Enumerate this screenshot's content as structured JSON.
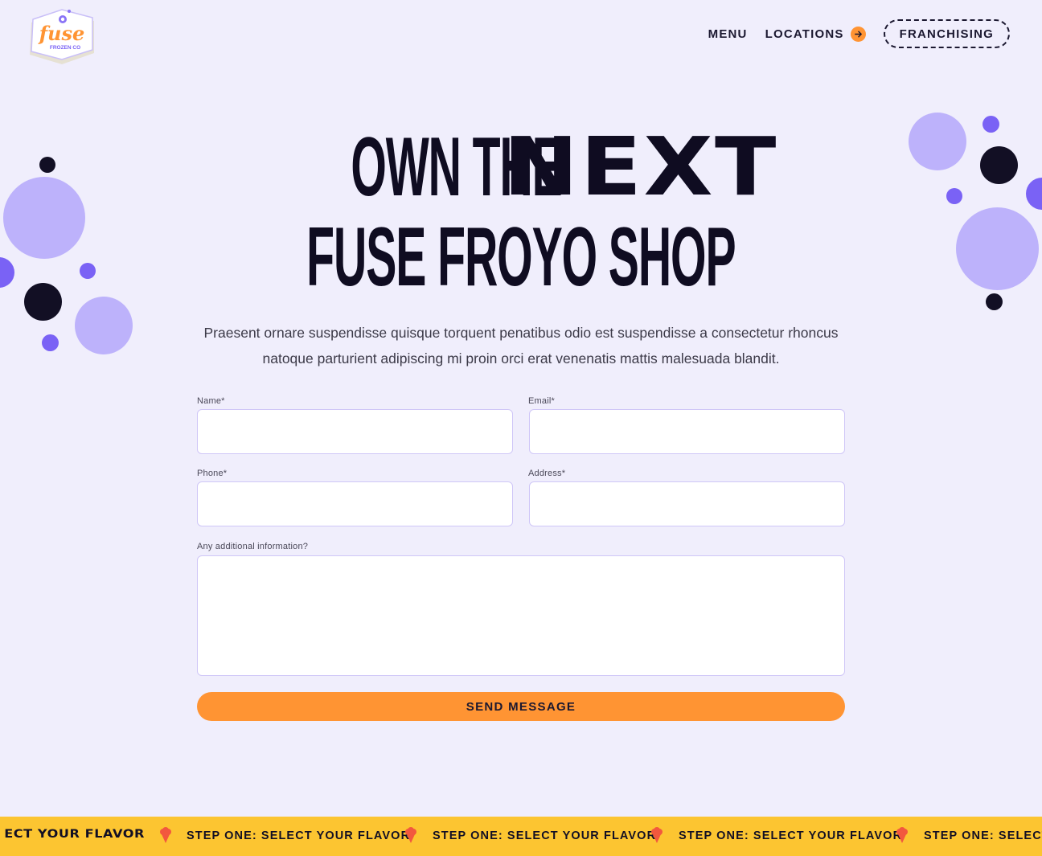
{
  "brand": {
    "logo_word": "fuse",
    "logo_sub": "FROZEN CO"
  },
  "nav": {
    "menu": "MENU",
    "locations": "LOCATIONS",
    "franchising": "FRANCHISING"
  },
  "hero": {
    "line1_part1": "OWN THE",
    "line1_part2": "NEXT",
    "line2": "FUSE FROYO SHOP",
    "intro": "Praesent ornare suspendisse quisque torquent penatibus odio est suspendisse a consectetur rhoncus natoque parturient adipiscing mi proin orci erat venenatis mattis malesuada blandit."
  },
  "form": {
    "name_label": "Name*",
    "email_label": "Email*",
    "phone_label": "Phone*",
    "address_label": "Address*",
    "info_label": "Any additional information?",
    "name_value": "",
    "email_value": "",
    "phone_value": "",
    "address_value": "",
    "info_value": "",
    "submit": "SEND MESSAGE"
  },
  "ticker": {
    "partial": "ECT YOUR FLAVOR",
    "item1": "STEP ONE: SELECT YOUR FLAVOR",
    "item2": "STEP ONE: SELECT YOUR FLAVOR",
    "item3": "STEP ONE: SELECT YOUR FLAVOR",
    "item4": "STEP ONE: SELECT"
  },
  "colors": {
    "background": "#f0eefc",
    "accent_orange": "#ff9433",
    "lavender": "#bdb2fb",
    "purple": "#7a62f5",
    "dark": "#120f24",
    "ticker_yellow": "#fcc531"
  },
  "icons": [
    "fuse-logo",
    "arrow-right-icon",
    "ice-cream-icon"
  ]
}
